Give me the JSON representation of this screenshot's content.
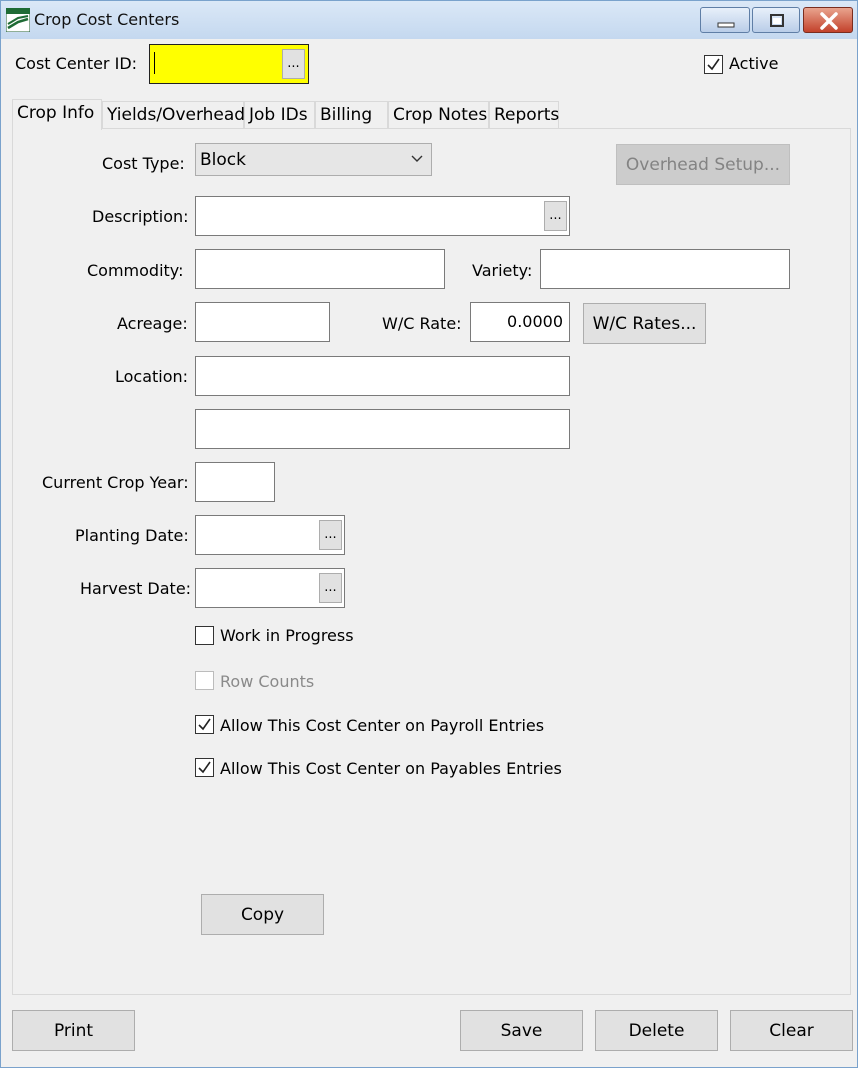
{
  "window": {
    "title": "Crop Cost Centers",
    "icon": "app-logo-icon"
  },
  "header": {
    "cost_center_id_label": "Cost Center  ID:",
    "cost_center_id_value": "",
    "ellipsis_label": "...",
    "active_label": "Active",
    "active_checked": true,
    "id_field_color": "#ffff00"
  },
  "tabs": [
    {
      "label": "Crop Info",
      "active": true
    },
    {
      "label": "Yields/Overhead",
      "active": false
    },
    {
      "label": "Job IDs",
      "active": false
    },
    {
      "label": "Billing",
      "active": false
    },
    {
      "label": "Crop Notes",
      "active": false
    },
    {
      "label": "Reports",
      "active": false
    }
  ],
  "form": {
    "cost_type_label": "Cost Type:",
    "cost_type_value": "Block",
    "overhead_setup_label": "Overhead Setup...",
    "description_label": "Description:",
    "description_value": "",
    "commodity_label": "Commodity:",
    "commodity_value": "",
    "variety_label": "Variety:",
    "variety_value": "",
    "acreage_label": "Acreage:",
    "acreage_value": "",
    "wc_rate_label": "W/C Rate:",
    "wc_rate_value": "0.0000",
    "wc_rates_button": "W/C Rates...",
    "location_label": "Location:",
    "location_line1": "",
    "location_line2": "",
    "current_crop_year_label": "Current Crop Year:",
    "current_crop_year_value": "",
    "planting_date_label": "Planting Date:",
    "planting_date_value": "",
    "harvest_date_label": "Harvest Date:",
    "harvest_date_value": "",
    "ellipsis_label": "...",
    "work_in_progress_label": "Work in Progress",
    "work_in_progress_checked": false,
    "row_counts_label": "Row Counts",
    "row_counts_checked": false,
    "row_counts_enabled": false,
    "allow_payroll_label": "Allow This Cost Center on Payroll Entries",
    "allow_payroll_checked": true,
    "allow_payables_label": "Allow This Cost Center on Payables Entries",
    "allow_payables_checked": true,
    "copy_button": "Copy"
  },
  "footer": {
    "print_button": "Print",
    "save_button": "Save",
    "delete_button": "Delete",
    "clear_button": "Clear"
  }
}
